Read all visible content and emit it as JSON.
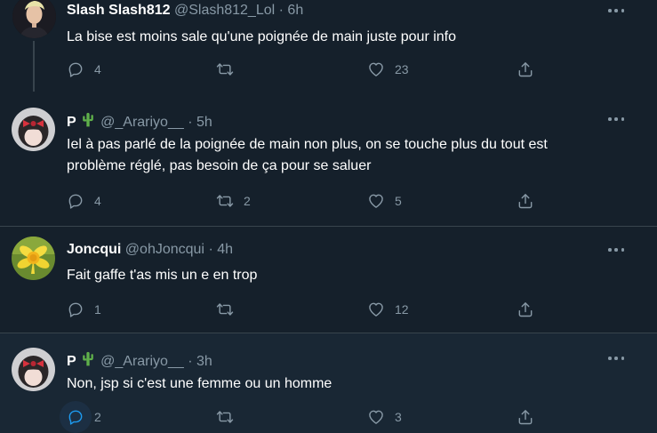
{
  "tweets": [
    {
      "name": "Slash Slash812",
      "handle": "@Slash812_Lol",
      "dot": "·",
      "time": "6h",
      "text": "La bise est moins sale qu'une poignée de main juste pour info",
      "reply_count": "4",
      "retweet_count": "",
      "like_count": "23",
      "avatar_icon": "avatar-person-blonde"
    },
    {
      "name": "P",
      "name_emoji": "cactus",
      "handle": "@_Arariyo__",
      "dot": "·",
      "time": "5h",
      "text": "Iel à pas parlé de la poignée de main non plus, on se touche plus du tout est problème réglé, pas besoin de ça pour se saluer",
      "reply_count": "4",
      "retweet_count": "2",
      "like_count": "5",
      "avatar_icon": "avatar-girl-red-bow"
    },
    {
      "name": "Joncqui",
      "handle": "@ohJoncqui",
      "dot": "·",
      "time": "4h",
      "text": "Fait gaffe t'as mis un e en trop",
      "reply_count": "1",
      "retweet_count": "",
      "like_count": "12",
      "avatar_icon": "avatar-daffodil"
    },
    {
      "name": "P",
      "name_emoji": "cactus",
      "handle": "@_Arariyo__",
      "dot": "·",
      "time": "3h",
      "text": "Non, jsp si c'est une femme ou un homme",
      "reply_count": "2",
      "retweet_count": "",
      "like_count": "3",
      "avatar_icon": "avatar-girl-red-bow"
    }
  ],
  "colors": {
    "background": "#15202b",
    "hover_background": "#192734",
    "secondary_text": "#8899a6",
    "accent": "#1d9bf0",
    "cactus": "#5fb04a"
  },
  "icons": [
    "reply-icon",
    "retweet-icon",
    "like-icon",
    "share-icon",
    "more-icon"
  ]
}
